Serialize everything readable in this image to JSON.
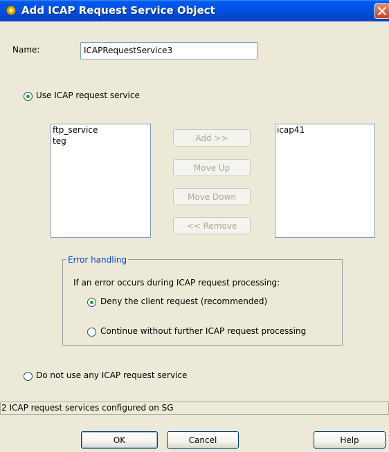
{
  "window": {
    "title": "Add ICAP Request Service Object"
  },
  "form": {
    "name_label": "Name:",
    "name_value": "ICAPRequestService3"
  },
  "use_service": {
    "label": "Use ICAP request service",
    "selected": true
  },
  "available_list": {
    "items": [
      "ftp_service",
      "teg"
    ]
  },
  "selected_list": {
    "items": [
      "icap41"
    ]
  },
  "list_buttons": {
    "add": "Add >>",
    "move_up": "Move Up",
    "move_down": "Move Down",
    "remove": "<< Remove"
  },
  "error_handling": {
    "legend": "Error handling",
    "description": "If an error occurs during ICAP request processing:",
    "options": [
      {
        "label": "Deny the client request (recommended)",
        "selected": true
      },
      {
        "label": "Continue without further ICAP request processing",
        "selected": false
      }
    ]
  },
  "no_service": {
    "label": "Do not use any ICAP request service",
    "selected": false
  },
  "status": {
    "text": "2 ICAP request services configured on SG"
  },
  "dialog_buttons": {
    "ok": "OK",
    "cancel": "Cancel",
    "help": "Help"
  }
}
